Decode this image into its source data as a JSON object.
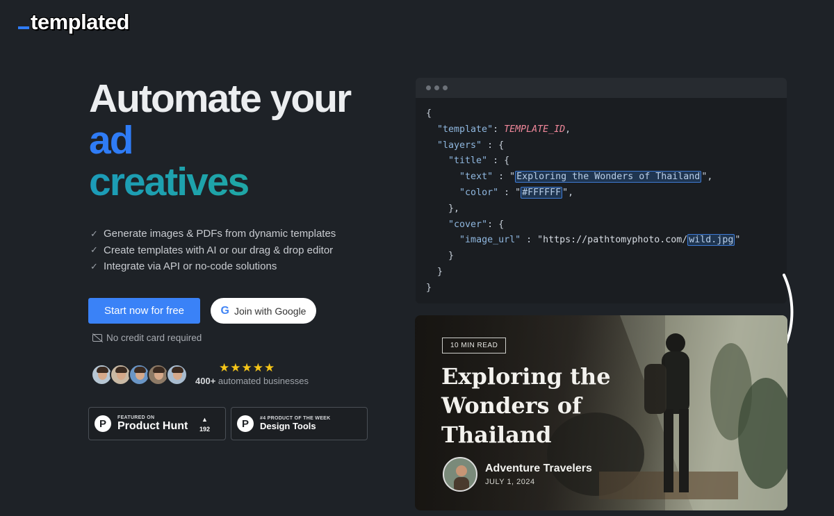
{
  "logo": {
    "text": "templated"
  },
  "hero": {
    "line1": "Automate your",
    "line2": "ad",
    "line3": "creatives"
  },
  "features": [
    "Generate images & PDFs from dynamic templates",
    "Create templates with AI or our drag & drop editor",
    "Integrate via API or no-code solutions"
  ],
  "cta": {
    "primary": "Start now for free",
    "google": "Join with Google",
    "no_card": "No credit card required"
  },
  "social_proof": {
    "stars": "★★★★★",
    "count": "400+",
    "label": " automated businesses"
  },
  "badges": {
    "ph_small": "FEATURED ON",
    "ph_big": "Product Hunt",
    "ph_votes": "192",
    "potw_small": "#4 PRODUCT OF THE WEEK",
    "potw_big": "Design Tools"
  },
  "code": {
    "l1": "{",
    "template_key": "\"template\"",
    "template_val": "TEMPLATE_ID",
    "layers_key": "\"layers\"",
    "title_key": "\"title\"",
    "text_key": "\"text\"",
    "text_val": "Exploring the Wonders of Thailand",
    "color_key": "\"color\"",
    "color_val": "#FFFFFF",
    "cover_key": "\"cover\"",
    "image_key": "\"image_url\"",
    "image_prefix": "https://pathtomyphoto.com/",
    "image_file": "wild.jpg"
  },
  "card": {
    "read_time": "10 MIN READ",
    "title": "Exploring the Wonders of Thailand",
    "author": "Adventure Travelers",
    "date": "JULY 1, 2024"
  },
  "colors": {
    "background": "#1e2227",
    "accent_blue": "#3a82f7",
    "highlight": "#3f7cd6"
  }
}
